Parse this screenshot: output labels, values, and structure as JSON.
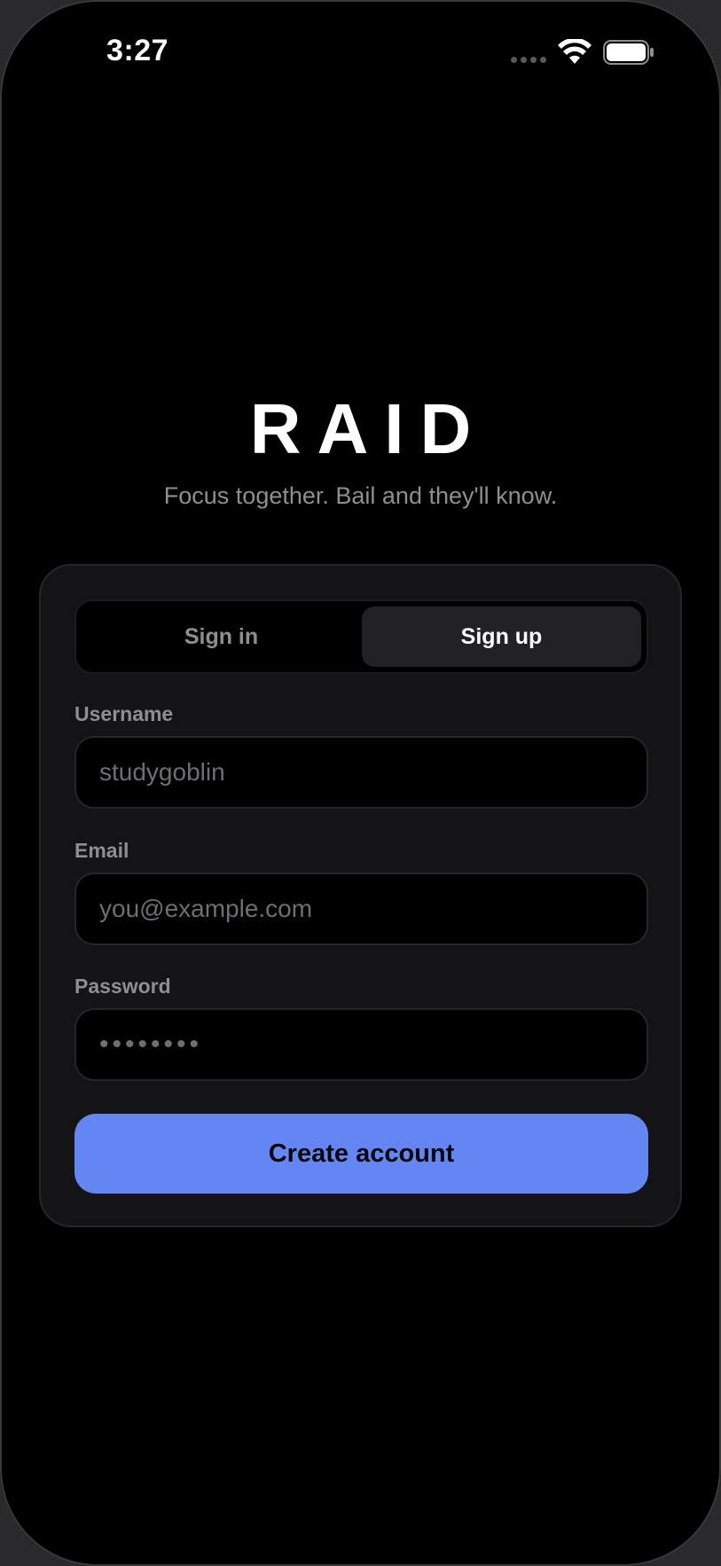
{
  "status_bar": {
    "time": "3:27"
  },
  "brand": {
    "title": "RAID",
    "tagline": "Focus together. Bail and they'll know."
  },
  "auth_tabs": {
    "sign_in": "Sign in",
    "sign_up": "Sign up",
    "selected": "Sign up"
  },
  "form": {
    "username": {
      "label": "Username",
      "value": "",
      "placeholder": "studygoblin"
    },
    "email": {
      "label": "Email",
      "value": "",
      "placeholder": "you@example.com"
    },
    "password": {
      "label": "Password",
      "value": "",
      "placeholder": "••••••••"
    }
  },
  "submit": {
    "label": "Create account"
  },
  "colors": {
    "accent": "#6486f2",
    "background": "#000000",
    "card": "#141416",
    "muted_text": "#8e8e93"
  }
}
